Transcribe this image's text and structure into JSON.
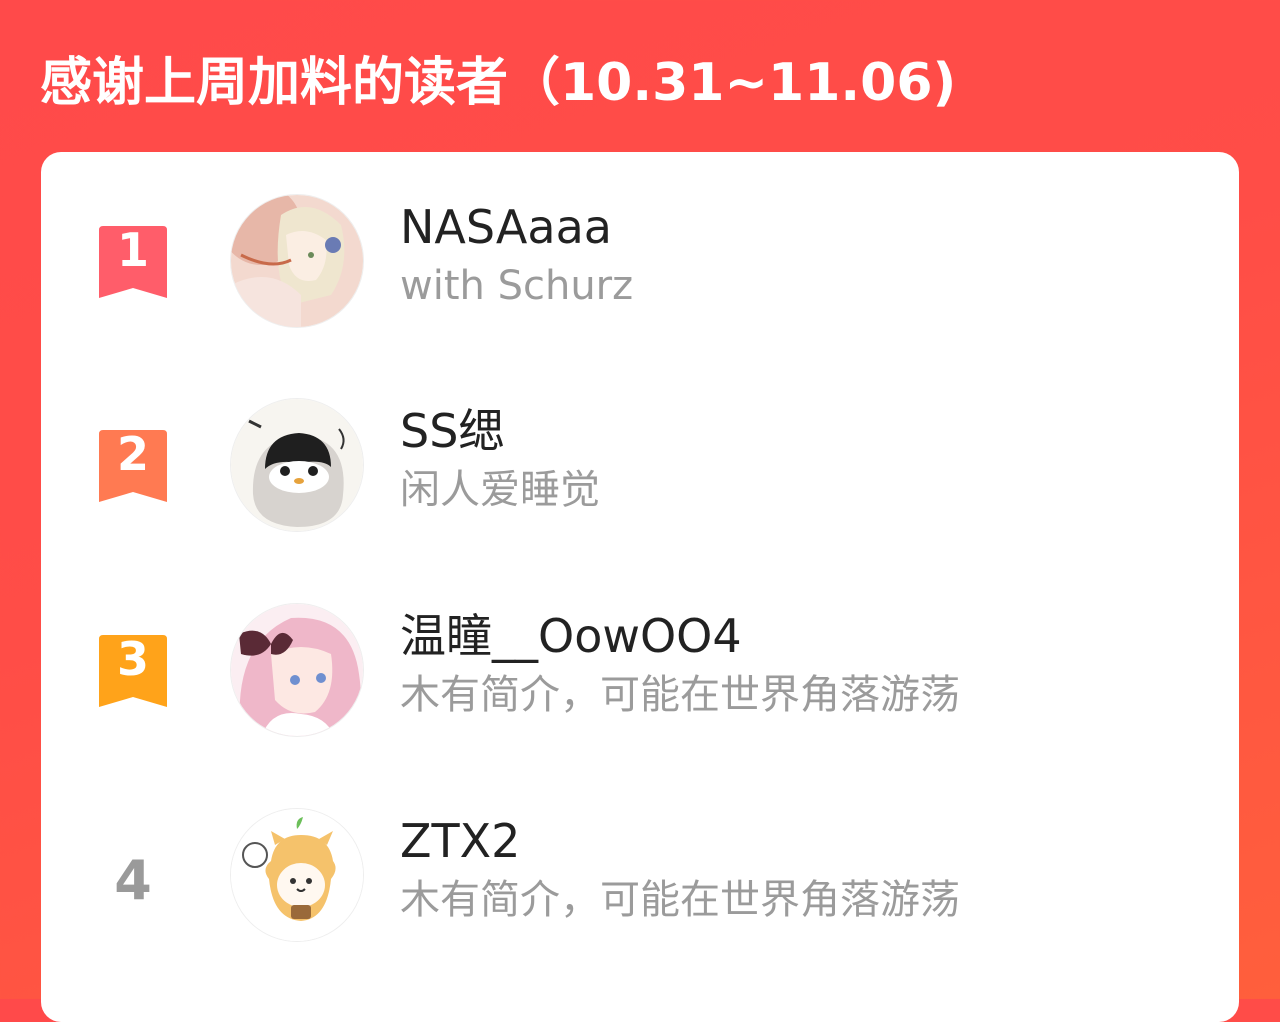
{
  "header": {
    "title": "感谢上周加料的读者（10.31~11.06)"
  },
  "colors": {
    "background": "#ff4a4a",
    "rank1": "#ff5d6a",
    "rank2": "#ff7a52",
    "rank3": "#ffa31a",
    "rank_plain": "#9a9a9a"
  },
  "readers": [
    {
      "rank": "1",
      "name": "NASAaaa",
      "bio": "with Schurz",
      "avatar_icon": "anime-girl-avatar-icon"
    },
    {
      "rank": "2",
      "name": "SS缌",
      "bio": "闲人爱睡觉",
      "avatar_icon": "penguin-avatar-icon"
    },
    {
      "rank": "3",
      "name": "温瞳__OowOO4",
      "bio": "木有简介，可能在世界角落游荡",
      "avatar_icon": "pink-hair-girl-avatar-icon"
    },
    {
      "rank": "4",
      "name": "ZTX2",
      "bio": "木有简介，可能在世界角落游荡",
      "avatar_icon": "cat-bear-avatar-icon"
    }
  ]
}
